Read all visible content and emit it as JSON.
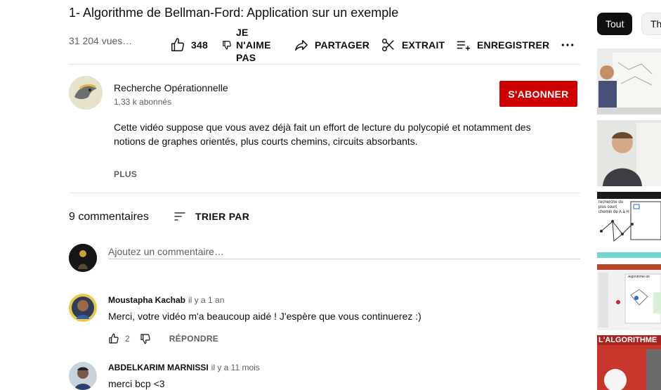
{
  "video": {
    "title": "1- Algorithme de Bellman-Ford: Application sur un exemple",
    "views": "31 204 vues…",
    "like_count": "348",
    "dislike_label": "JE N'AIME PAS",
    "share_label": "PARTAGER",
    "clip_label": "EXTRAIT",
    "save_label": "ENREGISTRER",
    "more_label": "…"
  },
  "channel": {
    "name": "Recherche Opérationnelle",
    "subscribers": "1,33 k abonnés",
    "subscribe_label": "S'ABONNER",
    "description": "Cette vidéo suppose que vous avez déjà fait un effort de lecture du polycopié et notamment des notions de graphes orientés, plus courts chemins, circuits absorbants.",
    "show_more_label": "PLUS"
  },
  "comments": {
    "count_label": "9 commentaires",
    "sort_label": "TRIER PAR",
    "add_placeholder": "Ajoutez un commentaire…",
    "items": [
      {
        "author": "Moustapha Kachab",
        "time": "il y a 1 an",
        "text": "Merci, votre vidéo m'a beaucoup aidé ! J'espère que vous continuerez :)",
        "likes": "2",
        "reply_label": "RÉPONDRE"
      },
      {
        "author": "ABDELKARIM MARNISSI",
        "time": "il y a 11 mois",
        "text": "merci bcp <3"
      }
    ]
  },
  "sidebar": {
    "chips": [
      "Tout",
      "Th"
    ],
    "thumbnails": [
      {
        "overlay_text": ""
      },
      {
        "overlay_text": ""
      },
      {
        "overlay_text": "recherche du plus court chemin de A à H"
      },
      {
        "overlay_text": "Algorithme de"
      },
      {
        "overlay_text": "L'ALGORITHME"
      }
    ]
  },
  "colors": {
    "subscribe": "#cc0000",
    "text": "#0f0f0f",
    "muted": "#606060",
    "chip_active": "#0f0f0f"
  }
}
